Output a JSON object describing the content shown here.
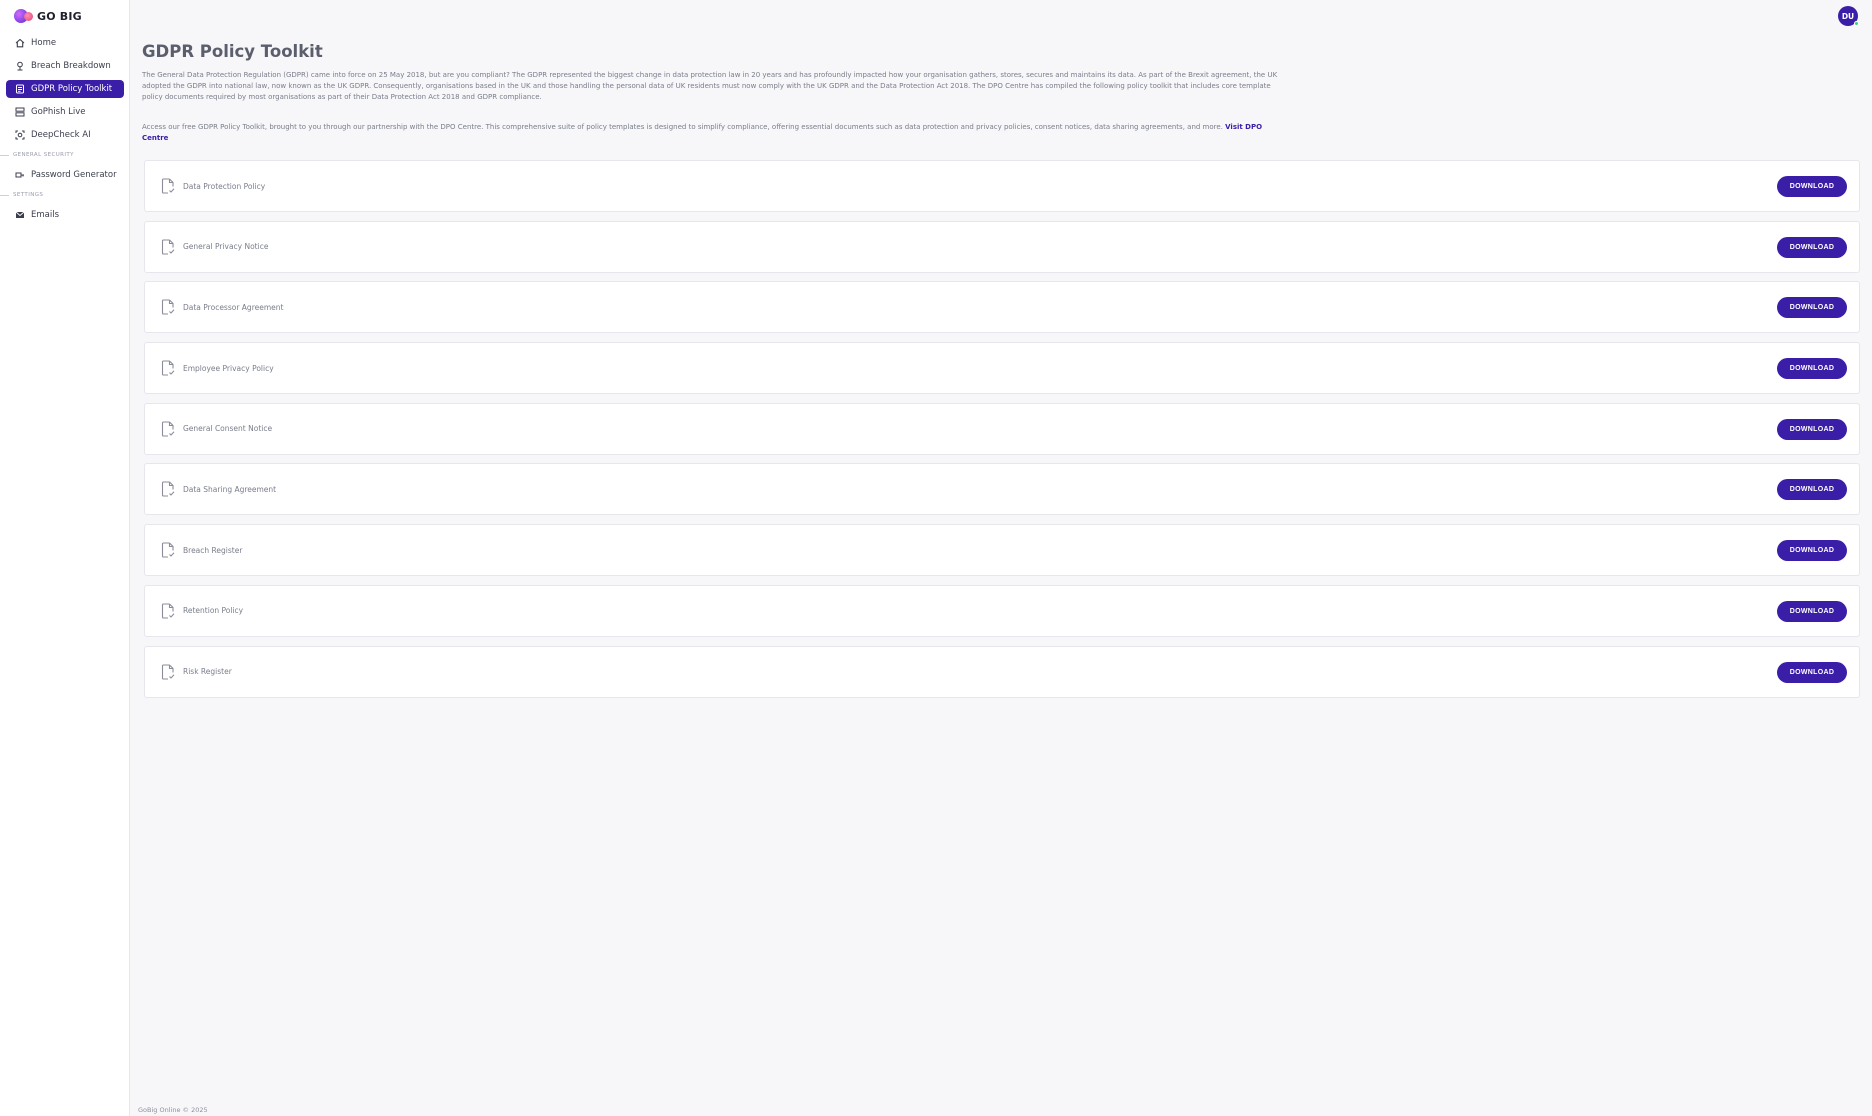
{
  "app": {
    "logo_text": "GO BIG"
  },
  "sidebar": {
    "items": [
      {
        "label": "Home",
        "icon": "home-icon"
      },
      {
        "label": "Breach Breakdown",
        "icon": "breach-icon"
      },
      {
        "label": "GDPR Policy Toolkit",
        "icon": "toolkit-icon",
        "active": true
      },
      {
        "label": "GoPhish Live",
        "icon": "server-icon"
      },
      {
        "label": "DeepCheck AI",
        "icon": "scan-icon"
      }
    ],
    "section_general": "GENERAL SECURITY",
    "general_items": [
      {
        "label": "Password Generator",
        "icon": "key-icon"
      }
    ],
    "section_settings": "SETTINGS",
    "settings_items": [
      {
        "label": "Emails",
        "icon": "mail-icon"
      }
    ]
  },
  "header": {
    "avatar_initials": "DU"
  },
  "page": {
    "title": "GDPR Policy Toolkit",
    "intro": "The General Data Protection Regulation (GDPR) came into force on 25 May 2018, but are you compliant? The GDPR represented the biggest change in data protection law in 20 years and has profoundly impacted how your organisation gathers, stores, secures and maintains its data. As part of the Brexit agreement, the UK adopted the GDPR into national law, now known as the UK GDPR. Consequently, organisations based in the UK and those handling the personal data of UK residents must now comply with the UK GDPR and the Data Protection Act 2018. The DPO Centre has compiled the following policy toolkit that includes core template policy documents required by most organisations as part of their Data Protection Act 2018 and GDPR compliance.",
    "access_text": "Access our free GDPR Policy Toolkit, brought to you through our partnership with the DPO Centre. This comprehensive suite of policy templates is designed to simplify compliance, offering essential documents such as data protection and privacy policies, consent notices, data sharing agreements, and more.",
    "visit_link": "Visit DPO Centre"
  },
  "documents": {
    "download_label": "DOWNLOAD",
    "items": [
      "Data Protection Policy",
      "General Privacy Notice",
      "Data Processor Agreement",
      "Employee Privacy Policy",
      "General Consent Notice",
      "Data Sharing Agreement",
      "Breach Register",
      "Retention Policy",
      "Risk Register"
    ]
  },
  "footer": {
    "text": "GoBig Online © 2025"
  },
  "colors": {
    "accent": "#3a1ea8",
    "background": "#f7f7f9"
  }
}
